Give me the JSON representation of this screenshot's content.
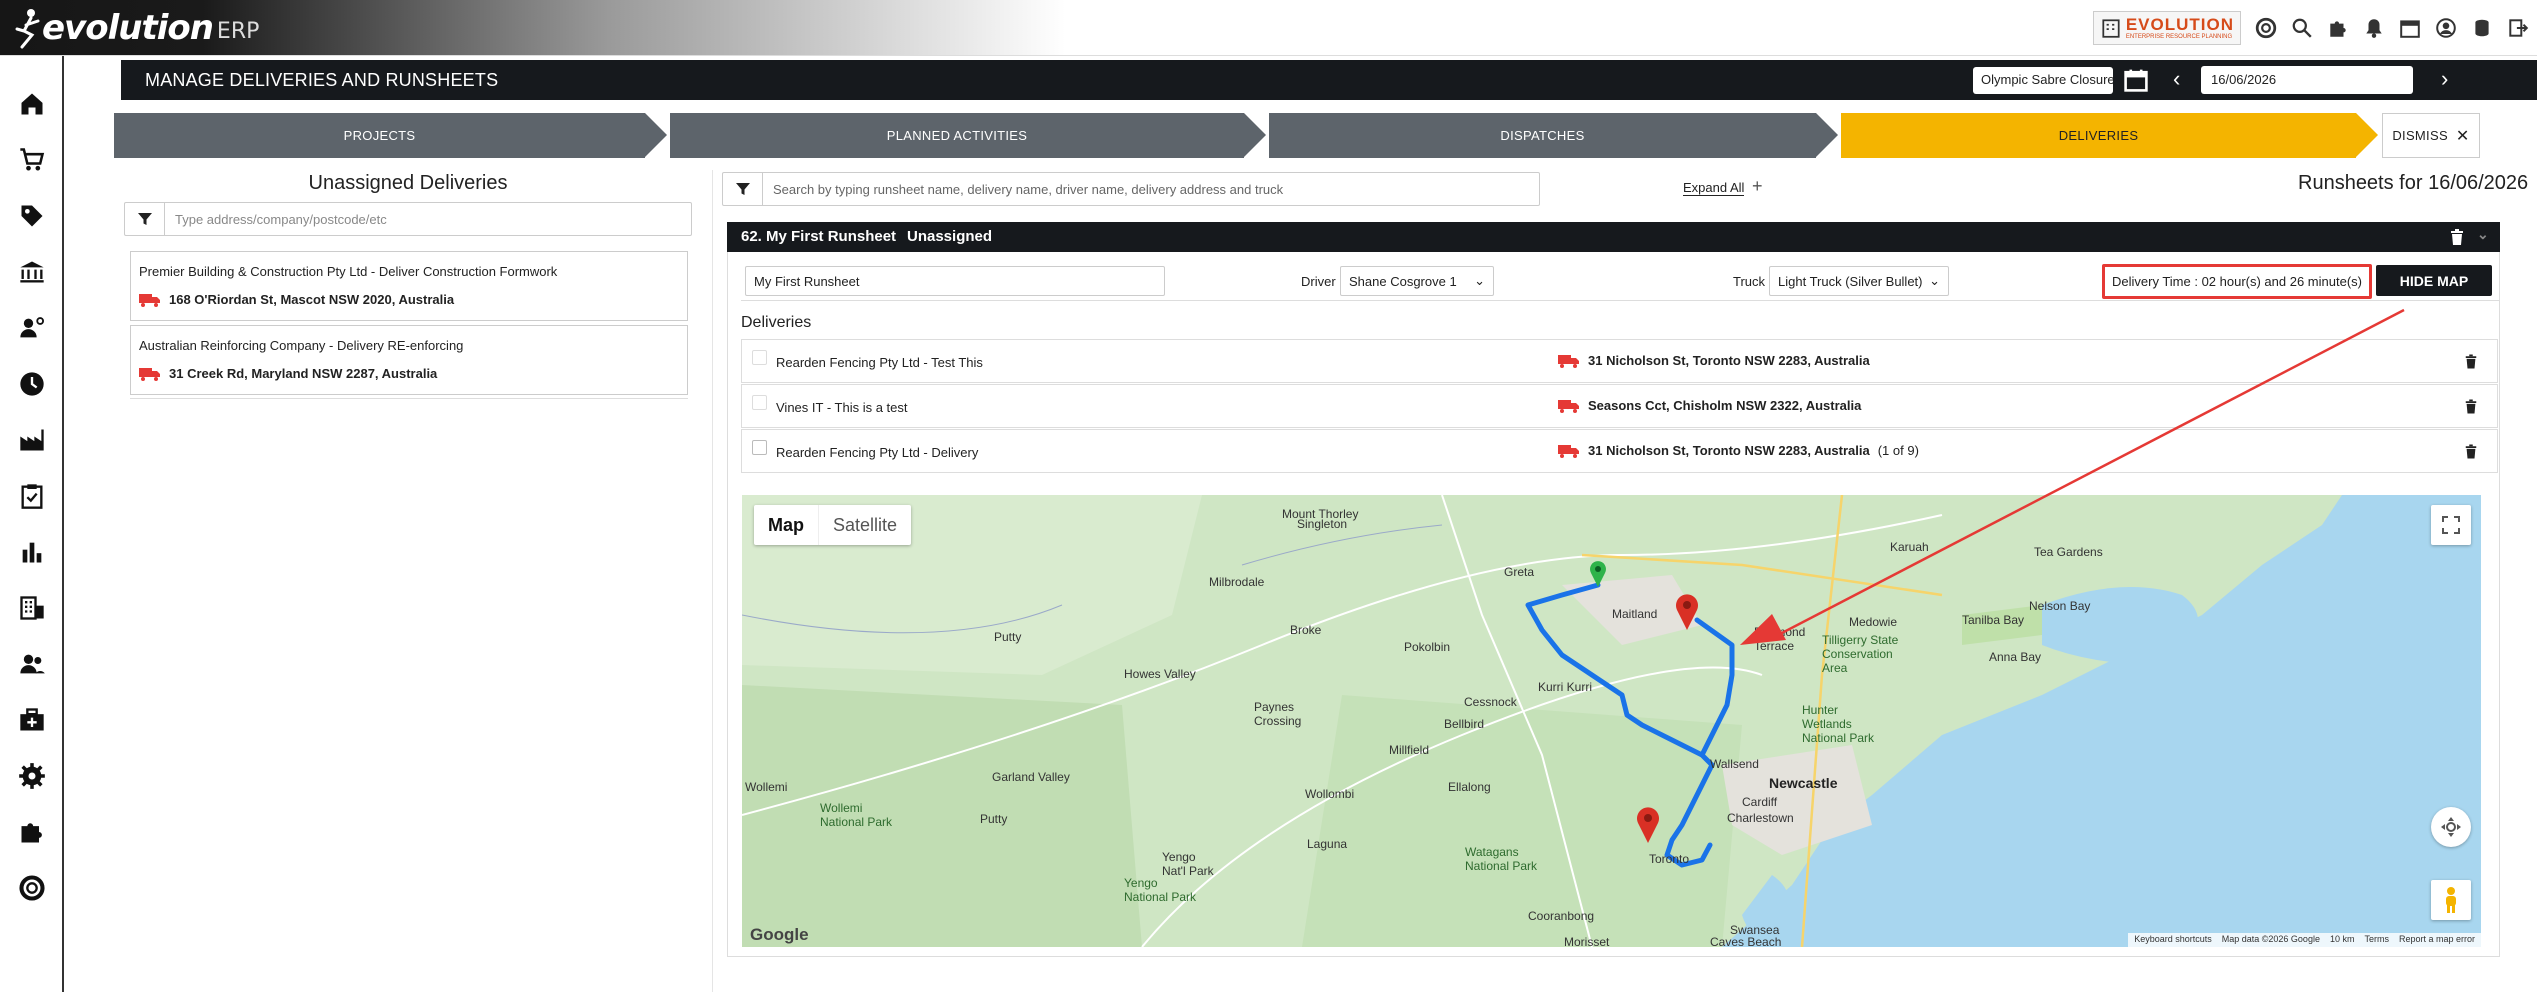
{
  "header": {
    "logo_text": "evolution",
    "logo_sub": "ERP",
    "brand_title": "EVOLUTION",
    "brand_sub": "ENTERPRISE RESOURCE PLANNING",
    "icons": [
      "building-icon",
      "search-icon",
      "lifebuoy-icon",
      "puzzle-icon",
      "bell-icon",
      "calendar-icon",
      "user-icon",
      "database-icon",
      "logout-icon"
    ]
  },
  "sidebar": {
    "items": [
      "home-icon",
      "cart-icon",
      "tag-icon",
      "bank-icon",
      "users-settings-icon",
      "clock-icon",
      "factory-icon",
      "clipboard-check-icon",
      "bar-chart-icon",
      "office-icon",
      "team-icon",
      "medkit-icon",
      "gear-icon",
      "puzzle-icon",
      "lifebuoy-icon"
    ]
  },
  "page": {
    "title": "MANAGE DELIVERIES AND RUNSHEETS",
    "location_select": "Olympic Sabre Closures",
    "date": "16/06/2026"
  },
  "steps": [
    {
      "label": "PROJECTS"
    },
    {
      "label": "PLANNED ACTIVITIES"
    },
    {
      "label": "DISPATCHES"
    },
    {
      "label": "DELIVERIES"
    },
    {
      "label": "DISMISS"
    }
  ],
  "unassigned": {
    "title": "Unassigned Deliveries",
    "filter_placeholder": "Type address/company/postcode/etc",
    "items": [
      {
        "name": "Premier Building & Construction Pty Ltd - Deliver Construction Formwork",
        "address": "168 O'Riordan St, Mascot NSW 2020, Australia"
      },
      {
        "name": "Australian Reinforcing Company - Delivery RE-enforcing",
        "address": "31 Creek Rd, Maryland NSW 2287, Australia"
      }
    ]
  },
  "runsheets": {
    "search_placeholder": "Search by typing runsheet name, delivery name, driver name, delivery address and truck",
    "expand_all": "Expand All",
    "title": "Runsheets for 16/06/2026",
    "runsheet": {
      "number_name": "62. My First Runsheet",
      "status": "Unassigned",
      "name_value": "My First Runsheet",
      "driver_label": "Driver",
      "driver_value": "Shane Cosgrove 1",
      "truck_label": "Truck",
      "truck_value": "Light Truck (Silver Bullet)",
      "delivery_time": "Delivery Time : 02 hour(s) and 26 minute(s)",
      "hide_map": "HIDE MAP",
      "deliveries_title": "Deliveries",
      "deliveries": [
        {
          "name": "Rearden Fencing Pty Ltd - Test This",
          "address": "31 Nicholson St, Toronto NSW 2283, Australia",
          "extra": ""
        },
        {
          "name": "Vines IT - This is a test",
          "address": "Seasons Cct, Chisholm NSW 2322, Australia",
          "extra": ""
        },
        {
          "name": "Rearden Fencing Pty Ltd - Delivery",
          "address": "31 Nicholson St, Toronto NSW 2283, Australia",
          "extra": "(1 of 9)"
        }
      ]
    }
  },
  "map": {
    "map_btn": "Map",
    "satellite_btn": "Satellite",
    "google": "Google",
    "footer": [
      "Keyboard shortcuts",
      "Map data ©2026 Google",
      "10 km",
      "Terms",
      "Report a map error"
    ],
    "places": [
      "Mount Thorley",
      "Singleton",
      "Milbrodale",
      "Greta",
      "Maitland",
      "Kurri Kurri",
      "Broke",
      "Putty",
      "Howes Valley",
      "Pokolbin",
      "Paynes Crossing",
      "Cessnock",
      "Bellbird",
      "Millfield",
      "Ellalong",
      "Wollombi",
      "Garland Valley",
      "Wollemi",
      "Wollemi National Park",
      "Putty",
      "Yengo Nat'l Park",
      "Yengo National Park",
      "Laguna",
      "Watagans National Park",
      "Cooranbong",
      "Morisset",
      "Toronto",
      "Swansea",
      "Caves Beach",
      "Cardiff",
      "Charlestown",
      "Newcastle",
      "Wallsend",
      "Hunter Wetlands National Park",
      "Raymond Terrace",
      "Medowie",
      "Tilligerry State Conservation Area",
      "Tanilba Bay",
      "Nelson Bay",
      "Anna Bay",
      "Karuah",
      "Tea Gardens"
    ]
  },
  "colors": {
    "dark": "#16191d",
    "step_gray": "#5d646b",
    "step_active": "#f4b400",
    "annotation_red": "#e53935",
    "route_blue": "#1a73e8"
  }
}
